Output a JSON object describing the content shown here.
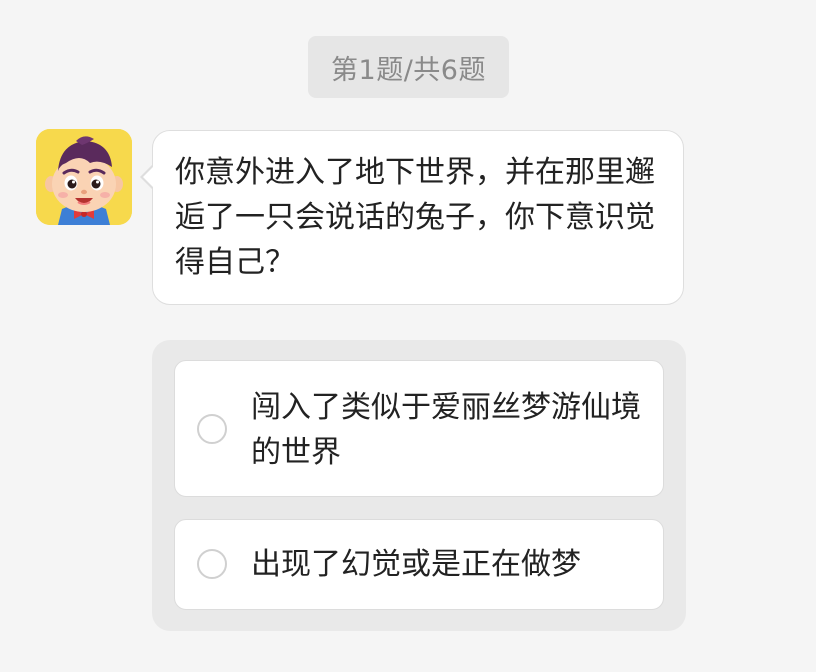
{
  "progress": {
    "label": "第1题/共6题",
    "current": 1,
    "total": 6
  },
  "avatar": {
    "icon": "cartoon-boy-avatar-icon",
    "background_color": "#f7d94c"
  },
  "question": {
    "text": "你意外进入了地下世界，并在那里邂逅了一只会说话的兔子，你下意识觉得自己？"
  },
  "options": [
    {
      "label": "闯入了类似于爱丽丝梦游仙境的世界",
      "selected": false
    },
    {
      "label": "出现了幻觉或是正在做梦",
      "selected": false
    }
  ],
  "colors": {
    "page_background": "#f5f5f5",
    "pill_background": "#e6e6e6",
    "pill_text": "#8a8a8a",
    "panel_background": "#e9e9e9",
    "card_background": "#ffffff",
    "text": "#222222"
  }
}
